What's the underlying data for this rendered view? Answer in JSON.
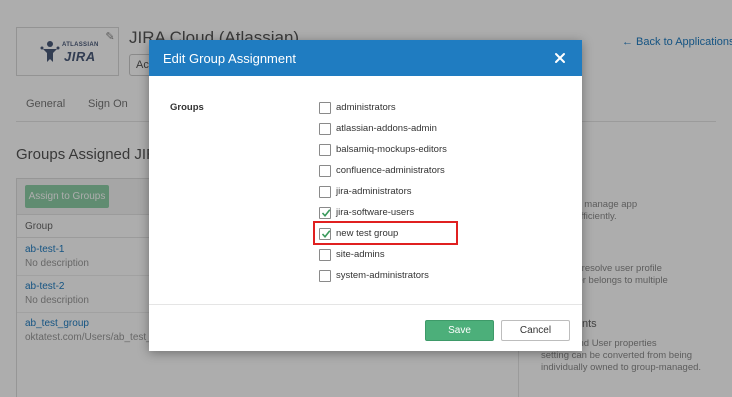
{
  "app": {
    "logo_small": "ATLASSIAN",
    "logo_big": "JIRA",
    "title": "JIRA Cloud (Atlassian)",
    "status_value": "Active",
    "back_link": "← Back to Applications",
    "tabs": [
      {
        "label": "General"
      },
      {
        "label": "Sign On"
      }
    ],
    "section_title": "Groups Assigned JIRA",
    "assign_button": "Assign to Groups",
    "group_column_header": "Group",
    "groups": [
      {
        "name": "ab-test-1",
        "description": "No description"
      },
      {
        "name": "ab-test-2",
        "description": "No description"
      },
      {
        "name": "ab_test_group",
        "description": "oktatest.com/Users/ab_test_gro"
      }
    ],
    "right_panel": {
      "text1": "ow you to manage app",
      "text2": "ts more efficiently.",
      "heading2": "ority",
      "text3": "rity helps resolve user profile",
      "text4": "hen a user belongs to multiple",
      "text5": "e",
      "heading3": "ssignments",
      "text6": "access and User properties",
      "text7": "setting can be converted from being",
      "text8": "individually owned to group-managed."
    }
  },
  "modal": {
    "title": "Edit Group Assignment",
    "groups_label": "Groups",
    "options": [
      {
        "label": "administrators",
        "checked": false
      },
      {
        "label": "atlassian-addons-admin",
        "checked": false
      },
      {
        "label": "balsamiq-mockups-editors",
        "checked": false
      },
      {
        "label": "confluence-administrators",
        "checked": false
      },
      {
        "label": "jira-administrators",
        "checked": false
      },
      {
        "label": "jira-software-users",
        "checked": true
      },
      {
        "label": "new test group",
        "checked": true
      },
      {
        "label": "site-admins",
        "checked": false
      },
      {
        "label": "system-administrators",
        "checked": false
      }
    ],
    "save_label": "Save",
    "cancel_label": "Cancel"
  },
  "colors": {
    "header_blue": "#1f7cc1",
    "save_green": "#4caf7a",
    "highlight_red": "#e02020",
    "check_green": "#3a9a5c"
  }
}
